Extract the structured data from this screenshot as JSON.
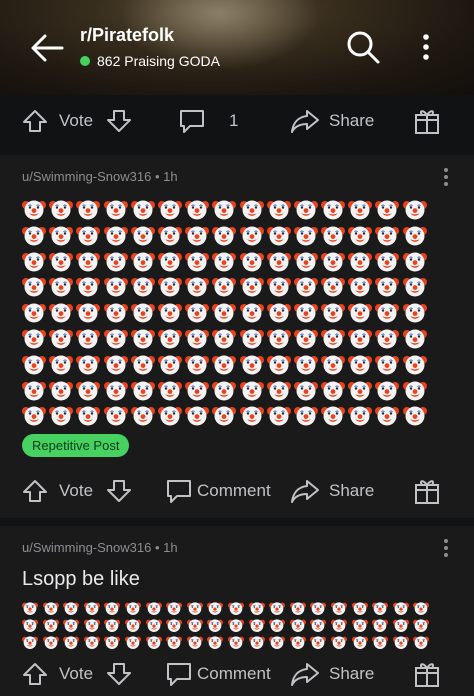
{
  "header": {
    "subreddit": "r/Piratefolk",
    "online_text": "862 Praising GODA",
    "online_color": "#46d160"
  },
  "top_bar": {
    "vote_label": "Vote",
    "comment_count": "1",
    "share_label": "Share"
  },
  "posts": [
    {
      "meta": "u/Swimming-Snow316 • 1h",
      "body_emoji": "clown-face",
      "emoji_count": 135,
      "flair": "Repetitive Post",
      "actions": {
        "vote_label": "Vote",
        "comment_label": "Comment",
        "share_label": "Share"
      }
    },
    {
      "meta": "u/Swimming-Snow316 • 1h",
      "title": "Lsopp be like",
      "body_emoji": "clown-face",
      "emoji_count": 60,
      "actions": {
        "vote_label": "Vote",
        "comment_label": "Comment",
        "share_label": "Share"
      }
    }
  ],
  "icons": [
    "back-arrow-icon",
    "search-icon",
    "more-vertical-icon",
    "upvote-icon",
    "downvote-icon",
    "comment-icon",
    "share-icon",
    "award-icon",
    "clown-face-icon"
  ]
}
